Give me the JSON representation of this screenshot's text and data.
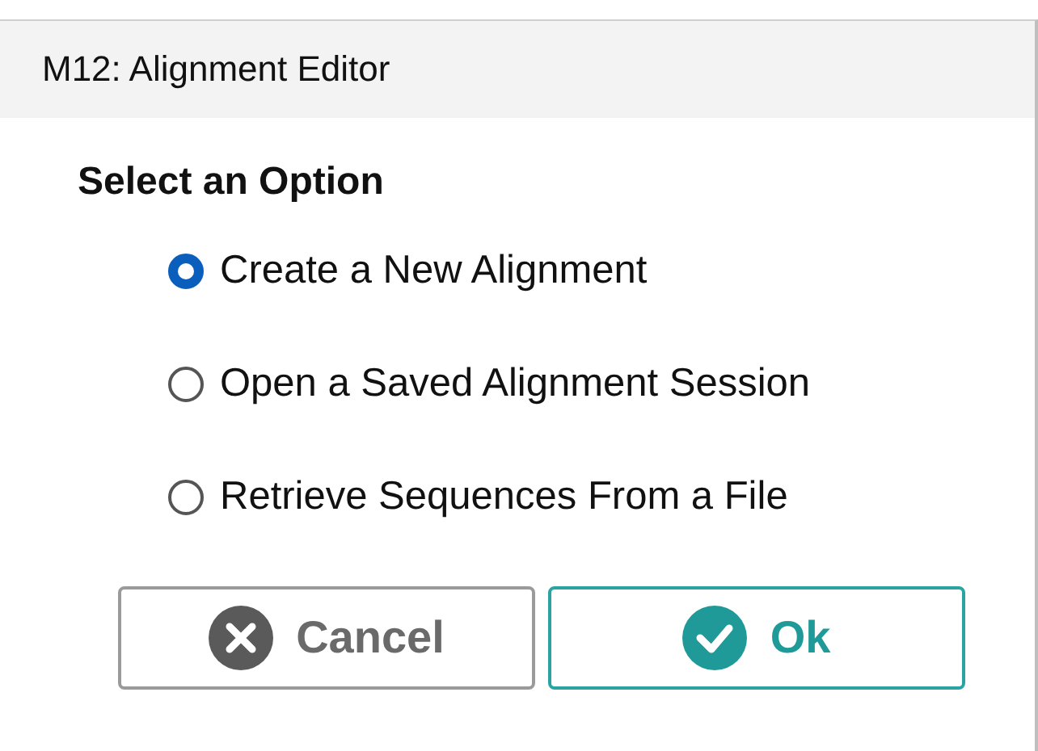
{
  "window": {
    "title": "M12: Alignment Editor"
  },
  "heading": "Select an Option",
  "options": [
    {
      "label": "Create a New Alignment",
      "selected": true
    },
    {
      "label": "Open a Saved Alignment Session",
      "selected": false
    },
    {
      "label": "Retrieve Sequences From a File",
      "selected": false
    }
  ],
  "buttons": [
    {
      "kind": "cancel",
      "label": "Cancel"
    },
    {
      "kind": "ok",
      "label": "Ok"
    }
  ]
}
